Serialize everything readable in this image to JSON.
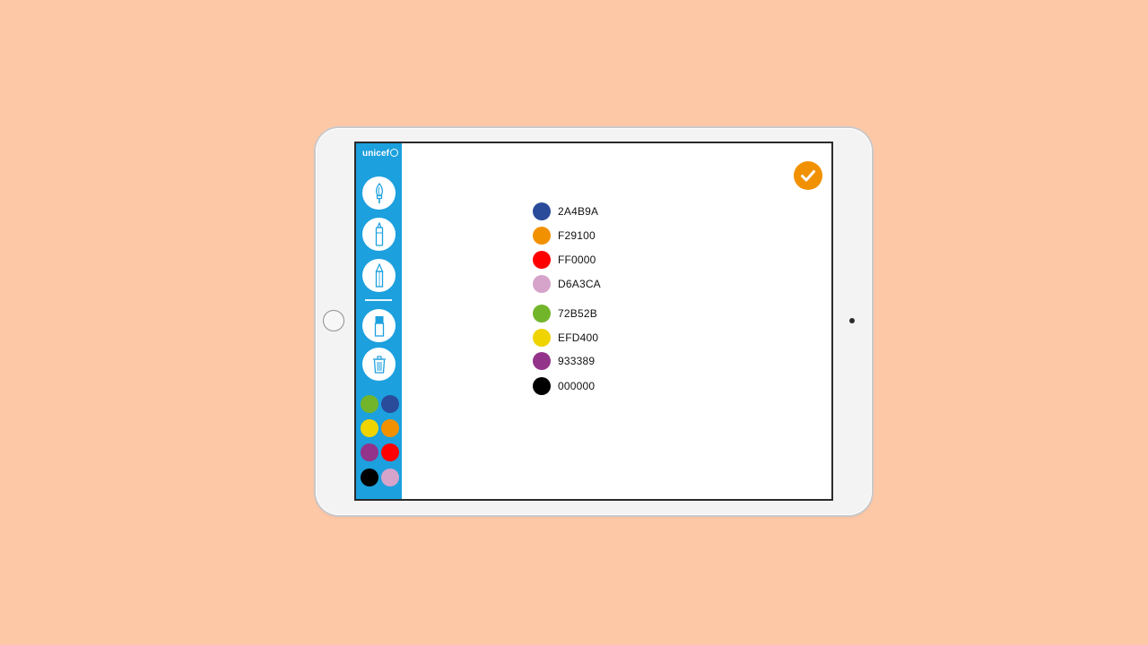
{
  "app": {
    "logo_text": "unicef"
  },
  "sidebar": {
    "tools": [
      {
        "name": "brush",
        "icon": "brush-icon"
      },
      {
        "name": "marker",
        "icon": "marker-icon"
      },
      {
        "name": "pencil",
        "icon": "pencil-icon"
      },
      {
        "name": "eraser",
        "icon": "eraser-icon"
      },
      {
        "name": "trash",
        "icon": "trash-icon"
      }
    ],
    "palette": [
      "#72B52B",
      "#2A4B9A",
      "#EFD400",
      "#F29100",
      "#933389",
      "#FF0000",
      "#000000",
      "#D6A3CA"
    ]
  },
  "confirm": {
    "icon": "checkmark-icon",
    "color": "#F29100"
  },
  "colors": [
    {
      "hex": "#2A4B9A",
      "label": "2A4B9A"
    },
    {
      "hex": "#F29100",
      "label": "F29100"
    },
    {
      "hex": "#FF0000",
      "label": "FF0000"
    },
    {
      "hex": "#D6A3CA",
      "label": "D6A3CA"
    },
    {
      "hex": "#72B52B",
      "label": "72B52B"
    },
    {
      "hex": "#EFD400",
      "label": "EFD400"
    },
    {
      "hex": "#933389",
      "label": "933389"
    },
    {
      "hex": "#000000",
      "label": "000000"
    }
  ],
  "theme": {
    "sidebar_color": "#1CA0DE",
    "background": "#FDC8A6"
  }
}
